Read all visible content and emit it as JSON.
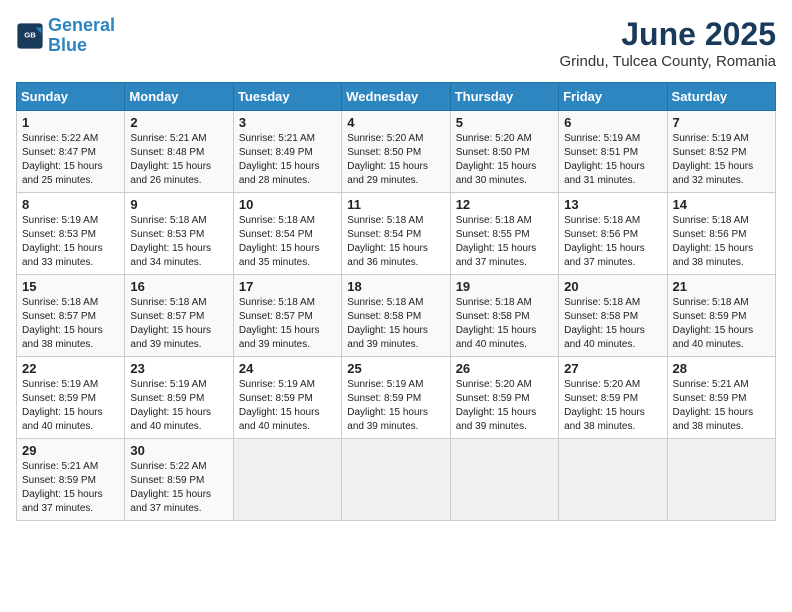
{
  "header": {
    "logo_line1": "General",
    "logo_line2": "Blue",
    "month": "June 2025",
    "location": "Grindu, Tulcea County, Romania"
  },
  "weekdays": [
    "Sunday",
    "Monday",
    "Tuesday",
    "Wednesday",
    "Thursday",
    "Friday",
    "Saturday"
  ],
  "weeks": [
    [
      {
        "day": "1",
        "info": "Sunrise: 5:22 AM\nSunset: 8:47 PM\nDaylight: 15 hours\nand 25 minutes."
      },
      {
        "day": "2",
        "info": "Sunrise: 5:21 AM\nSunset: 8:48 PM\nDaylight: 15 hours\nand 26 minutes."
      },
      {
        "day": "3",
        "info": "Sunrise: 5:21 AM\nSunset: 8:49 PM\nDaylight: 15 hours\nand 28 minutes."
      },
      {
        "day": "4",
        "info": "Sunrise: 5:20 AM\nSunset: 8:50 PM\nDaylight: 15 hours\nand 29 minutes."
      },
      {
        "day": "5",
        "info": "Sunrise: 5:20 AM\nSunset: 8:50 PM\nDaylight: 15 hours\nand 30 minutes."
      },
      {
        "day": "6",
        "info": "Sunrise: 5:19 AM\nSunset: 8:51 PM\nDaylight: 15 hours\nand 31 minutes."
      },
      {
        "day": "7",
        "info": "Sunrise: 5:19 AM\nSunset: 8:52 PM\nDaylight: 15 hours\nand 32 minutes."
      }
    ],
    [
      {
        "day": "8",
        "info": "Sunrise: 5:19 AM\nSunset: 8:53 PM\nDaylight: 15 hours\nand 33 minutes."
      },
      {
        "day": "9",
        "info": "Sunrise: 5:18 AM\nSunset: 8:53 PM\nDaylight: 15 hours\nand 34 minutes."
      },
      {
        "day": "10",
        "info": "Sunrise: 5:18 AM\nSunset: 8:54 PM\nDaylight: 15 hours\nand 35 minutes."
      },
      {
        "day": "11",
        "info": "Sunrise: 5:18 AM\nSunset: 8:54 PM\nDaylight: 15 hours\nand 36 minutes."
      },
      {
        "day": "12",
        "info": "Sunrise: 5:18 AM\nSunset: 8:55 PM\nDaylight: 15 hours\nand 37 minutes."
      },
      {
        "day": "13",
        "info": "Sunrise: 5:18 AM\nSunset: 8:56 PM\nDaylight: 15 hours\nand 37 minutes."
      },
      {
        "day": "14",
        "info": "Sunrise: 5:18 AM\nSunset: 8:56 PM\nDaylight: 15 hours\nand 38 minutes."
      }
    ],
    [
      {
        "day": "15",
        "info": "Sunrise: 5:18 AM\nSunset: 8:57 PM\nDaylight: 15 hours\nand 38 minutes."
      },
      {
        "day": "16",
        "info": "Sunrise: 5:18 AM\nSunset: 8:57 PM\nDaylight: 15 hours\nand 39 minutes."
      },
      {
        "day": "17",
        "info": "Sunrise: 5:18 AM\nSunset: 8:57 PM\nDaylight: 15 hours\nand 39 minutes."
      },
      {
        "day": "18",
        "info": "Sunrise: 5:18 AM\nSunset: 8:58 PM\nDaylight: 15 hours\nand 39 minutes."
      },
      {
        "day": "19",
        "info": "Sunrise: 5:18 AM\nSunset: 8:58 PM\nDaylight: 15 hours\nand 40 minutes."
      },
      {
        "day": "20",
        "info": "Sunrise: 5:18 AM\nSunset: 8:58 PM\nDaylight: 15 hours\nand 40 minutes."
      },
      {
        "day": "21",
        "info": "Sunrise: 5:18 AM\nSunset: 8:59 PM\nDaylight: 15 hours\nand 40 minutes."
      }
    ],
    [
      {
        "day": "22",
        "info": "Sunrise: 5:19 AM\nSunset: 8:59 PM\nDaylight: 15 hours\nand 40 minutes."
      },
      {
        "day": "23",
        "info": "Sunrise: 5:19 AM\nSunset: 8:59 PM\nDaylight: 15 hours\nand 40 minutes."
      },
      {
        "day": "24",
        "info": "Sunrise: 5:19 AM\nSunset: 8:59 PM\nDaylight: 15 hours\nand 40 minutes."
      },
      {
        "day": "25",
        "info": "Sunrise: 5:19 AM\nSunset: 8:59 PM\nDaylight: 15 hours\nand 39 minutes."
      },
      {
        "day": "26",
        "info": "Sunrise: 5:20 AM\nSunset: 8:59 PM\nDaylight: 15 hours\nand 39 minutes."
      },
      {
        "day": "27",
        "info": "Sunrise: 5:20 AM\nSunset: 8:59 PM\nDaylight: 15 hours\nand 38 minutes."
      },
      {
        "day": "28",
        "info": "Sunrise: 5:21 AM\nSunset: 8:59 PM\nDaylight: 15 hours\nand 38 minutes."
      }
    ],
    [
      {
        "day": "29",
        "info": "Sunrise: 5:21 AM\nSunset: 8:59 PM\nDaylight: 15 hours\nand 37 minutes."
      },
      {
        "day": "30",
        "info": "Sunrise: 5:22 AM\nSunset: 8:59 PM\nDaylight: 15 hours\nand 37 minutes."
      },
      {
        "day": "",
        "info": ""
      },
      {
        "day": "",
        "info": ""
      },
      {
        "day": "",
        "info": ""
      },
      {
        "day": "",
        "info": ""
      },
      {
        "day": "",
        "info": ""
      }
    ]
  ]
}
